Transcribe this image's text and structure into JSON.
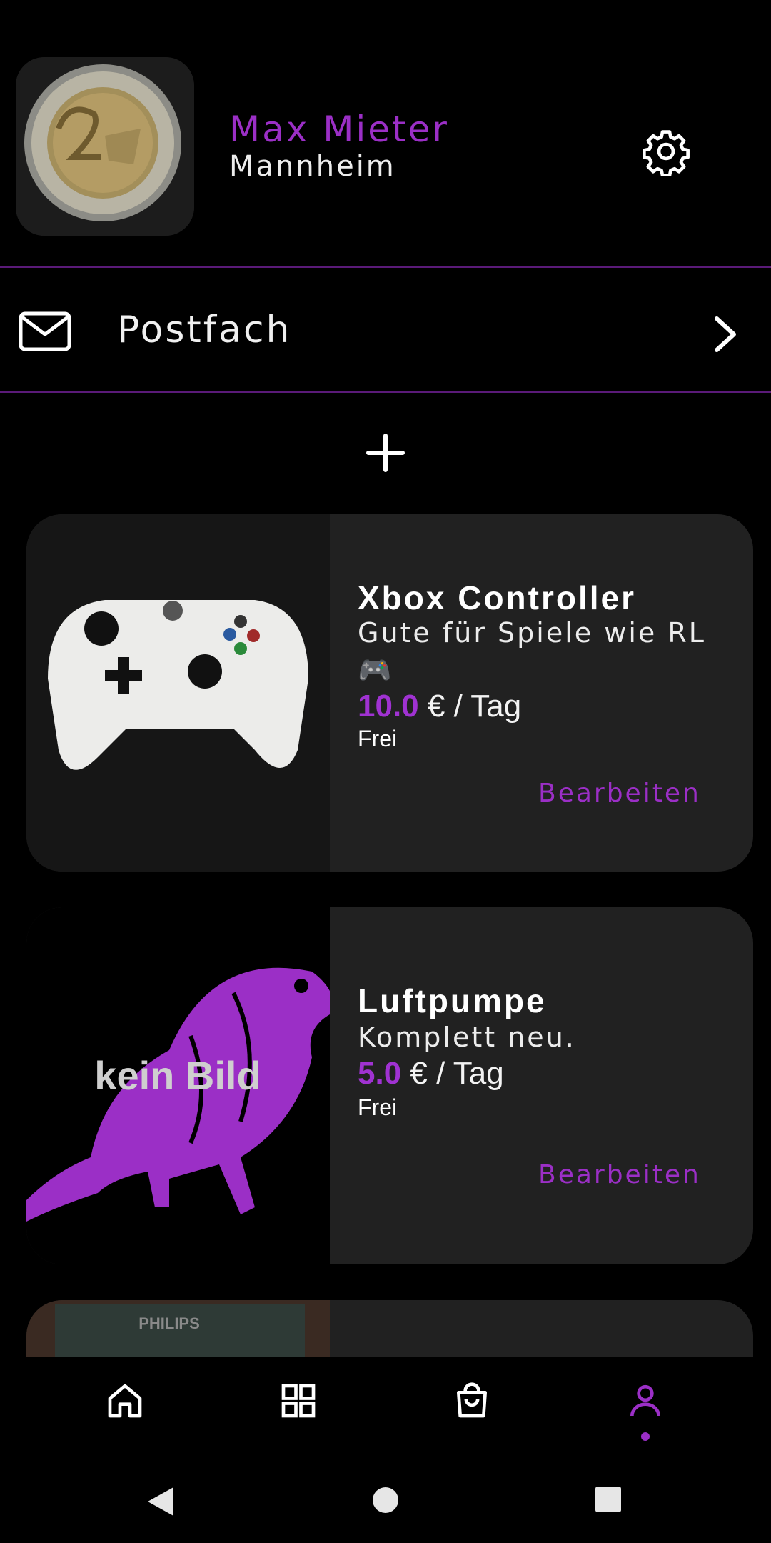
{
  "profile": {
    "name": "Max Mieter",
    "city": "Mannheim",
    "avatar_icon": "coin-photo",
    "settings_icon": "gear-icon"
  },
  "inbox": {
    "label": "Postfach",
    "icon": "mail-icon",
    "chevron_icon": "chevron-right-icon"
  },
  "add_button_icon": "plus-icon",
  "listings": [
    {
      "title": "Xbox Controller",
      "description": "Gute für Spiele wie RL 🎮",
      "price": "10.0",
      "price_unit": "€ / Tag",
      "status": "Frei",
      "edit_label": "Bearbeiten",
      "image": "controller-photo"
    },
    {
      "title": "Luftpumpe",
      "description": "Komplett neu.",
      "price": "5.0",
      "price_unit": "€ / Tag",
      "status": "Frei",
      "edit_label": "Bearbeiten",
      "image_text": "kein Bild"
    },
    {
      "image_text": "PHILIPS"
    }
  ],
  "bottom_nav": {
    "items": [
      "home-icon",
      "grid-icon",
      "shopping-bag-icon",
      "profile-icon"
    ],
    "active": "profile-icon"
  },
  "colors": {
    "accent": "#9b2fc6",
    "card_bg": "#212121",
    "divider": "#5a1a78"
  }
}
